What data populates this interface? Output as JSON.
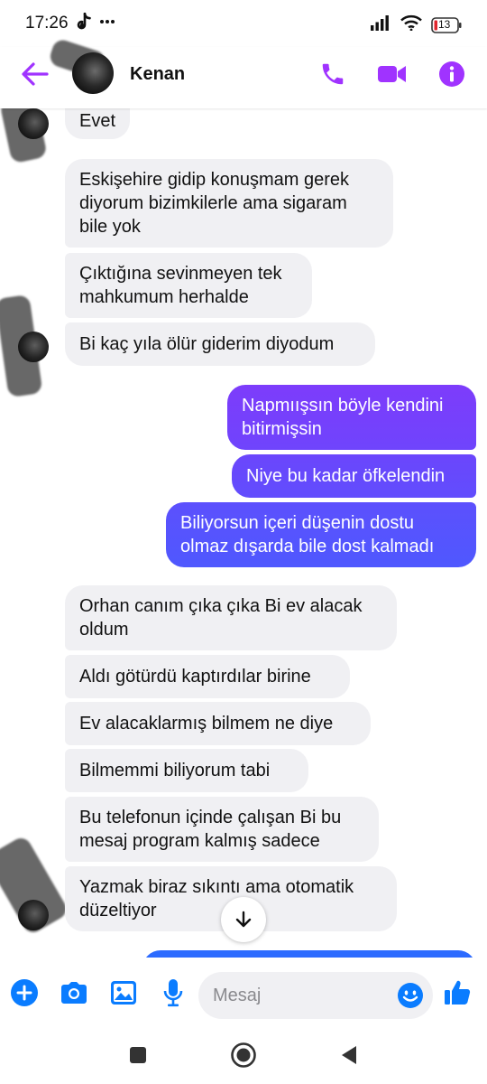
{
  "status_bar": {
    "time": "17:26",
    "battery": "13",
    "icons": [
      "tiktok-icon",
      "more-dots-icon",
      "signal-icon",
      "wifi-icon",
      "battery-icon"
    ]
  },
  "header": {
    "contact_name": "Kenan",
    "icons": [
      "back-arrow-icon",
      "phone-icon",
      "video-icon",
      "info-icon"
    ],
    "accent_color": "#a033ff"
  },
  "messages": [
    {
      "direction": "incoming",
      "text": "Evet"
    },
    {
      "direction": "incoming",
      "text": "Eskişehire gidip konuşmam gerek diyorum bizimkilerle ama sigaram bile yok"
    },
    {
      "direction": "incoming",
      "text": "Çıktığına sevinmeyen tek mahkumum herhalde"
    },
    {
      "direction": "incoming",
      "text": "Bi kaç yıla ölür giderim diyodum"
    },
    {
      "direction": "outgoing",
      "text": "Napmıışsın böyle kendini bitirmişsin"
    },
    {
      "direction": "outgoing",
      "text": "Niye bu kadar öfkelendin"
    },
    {
      "direction": "outgoing",
      "text": "Biliyorsun içeri düşenin dostu olmaz dışarda bile dost kalmadı"
    },
    {
      "direction": "incoming",
      "text": "Orhan canım çıka çıka Bi ev alacak oldum"
    },
    {
      "direction": "incoming",
      "text": "Aldı götürdü kaptırdılar birine"
    },
    {
      "direction": "incoming",
      "text": "Ev alacaklarmış bilmem ne diye"
    },
    {
      "direction": "incoming",
      "text": "Bilmemmi biliyorum tabi"
    },
    {
      "direction": "incoming",
      "text": "Bu telefonun içinde çalışan Bi bu mesaj program kalmış sadece"
    },
    {
      "direction": "incoming",
      "text": "Yazmak biraz sıkıntı ama otomatik düzeltiyor"
    }
  ],
  "composer": {
    "placeholder": "Mesaj",
    "icons": [
      "plus-icon",
      "camera-icon",
      "image-icon",
      "microphone-icon",
      "emoji-icon",
      "thumbs-up-icon"
    ],
    "icon_color": "#0a7cff"
  },
  "colors": {
    "incoming_bubble": "#f0f0f3",
    "outgoing_gradient_top": "#8b3dfa",
    "outgoing_gradient_bottom": "#3b5bff"
  },
  "nav_bar": {
    "icons": [
      "recent-apps-icon",
      "home-icon",
      "back-icon"
    ]
  }
}
